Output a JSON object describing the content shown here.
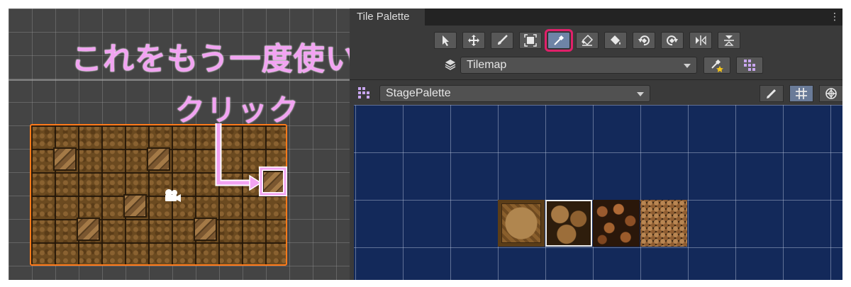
{
  "annotation": {
    "title": "これをもう一度使いたい",
    "click_label": "クリック"
  },
  "colors": {
    "annotation_pink": "#f2a3f2",
    "selection_orange": "#ff7a1a",
    "active_tool_highlight": "#e0206a",
    "palette_grid_background": "#13295a"
  },
  "scene": {
    "camera_icon": "camera-gizmo-icon"
  },
  "tile_palette": {
    "tab_title": "Tile Palette",
    "menu_icon": "kebab-menu-icon",
    "tools": [
      {
        "name": "select-tool",
        "icon": "arrow-pointer-icon",
        "active": false
      },
      {
        "name": "move-tool",
        "icon": "move-arrows-icon",
        "active": false
      },
      {
        "name": "paint-tool",
        "icon": "brush-icon",
        "active": false
      },
      {
        "name": "box-fill-tool",
        "icon": "box-fill-icon",
        "active": false
      },
      {
        "name": "picker-tool",
        "icon": "eyedropper-icon",
        "active": true
      },
      {
        "name": "erase-tool",
        "icon": "eraser-icon",
        "active": false
      },
      {
        "name": "fill-tool",
        "icon": "paint-bucket-icon",
        "active": false
      },
      {
        "name": "rotate-ccw-tool",
        "icon": "rotate-left-icon",
        "active": false
      },
      {
        "name": "rotate-cw-tool",
        "icon": "rotate-right-icon",
        "active": false
      },
      {
        "name": "flip-x-tool",
        "icon": "flip-horizontal-icon",
        "active": false
      },
      {
        "name": "flip-y-tool",
        "icon": "flip-vertical-icon",
        "active": false
      }
    ],
    "active_target": "Tilemap",
    "palette_name": "StagePalette",
    "edit_tools": [
      "pencil-icon",
      "grid-icon",
      "gizmo-icon"
    ],
    "tiles": [
      "tile-dirt-block",
      "tile-stone-large",
      "tile-cobble-medium",
      "tile-gravel-small"
    ],
    "selected_tile_index": 1
  }
}
